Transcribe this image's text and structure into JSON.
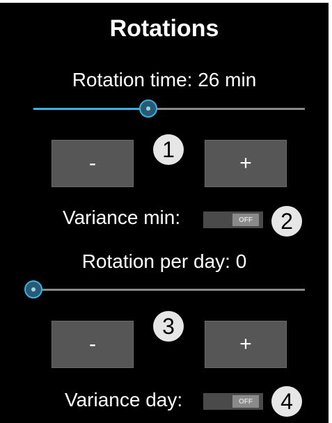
{
  "title": "Rotations",
  "rotation_time": {
    "label": "Rotation time: 26 min",
    "slider_value_fraction": 0.42,
    "minus_label": "-",
    "plus_label": "+"
  },
  "variance_min": {
    "label": "Variance min:",
    "toggle_text": "OFF"
  },
  "rotation_per_day": {
    "label": "Rotation per day: 0",
    "slider_value_fraction": 0.0,
    "minus_label": "-",
    "plus_label": "+"
  },
  "variance_day": {
    "label": "Variance day:",
    "toggle_text": "OFF"
  },
  "badges": [
    "1",
    "2",
    "3",
    "4"
  ],
  "colors": {
    "background": "#000000",
    "accent": "#33b5e5",
    "button": "#565656",
    "badge": "#e6e6e6"
  }
}
